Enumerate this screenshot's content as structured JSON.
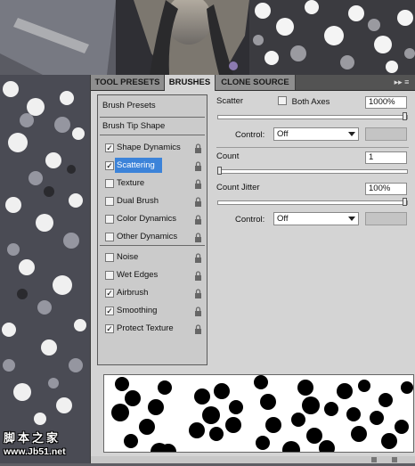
{
  "tabs": [
    {
      "label": "TOOL PRESETS",
      "active": false
    },
    {
      "label": "BRUSHES",
      "active": true
    },
    {
      "label": "CLONE SOURCE",
      "active": false
    }
  ],
  "menu_icon": "panel-menu-icon",
  "left_panel": {
    "brush_presets": "Brush Presets",
    "brush_tip_shape": "Brush Tip Shape",
    "options": [
      {
        "label": "Shape Dynamics",
        "checked": true,
        "selected": false
      },
      {
        "label": "Scattering",
        "checked": true,
        "selected": true
      },
      {
        "label": "Texture",
        "checked": false,
        "selected": false
      },
      {
        "label": "Dual Brush",
        "checked": false,
        "selected": false
      },
      {
        "label": "Color Dynamics",
        "checked": false,
        "selected": false
      },
      {
        "label": "Other Dynamics",
        "checked": false,
        "selected": false
      },
      {
        "label": "Noise",
        "checked": false,
        "selected": false
      },
      {
        "label": "Wet Edges",
        "checked": false,
        "selected": false
      },
      {
        "label": "Airbrush",
        "checked": true,
        "selected": false
      },
      {
        "label": "Smoothing",
        "checked": true,
        "selected": false
      },
      {
        "label": "Protect Texture",
        "checked": true,
        "selected": false
      }
    ]
  },
  "scatter": {
    "label": "Scatter",
    "both_axes_label": "Both Axes",
    "both_axes_checked": false,
    "value": "1000%",
    "slider_fraction": 1.0,
    "control_label": "Control:",
    "control_value": "Off"
  },
  "count": {
    "label": "Count",
    "value": "1",
    "slider_fraction": 0.0
  },
  "count_jitter": {
    "label": "Count Jitter",
    "value": "100%",
    "slider_fraction": 1.0,
    "control_label": "Control:",
    "control_value": "Off"
  },
  "watermark": {
    "line1": "脚本之家",
    "line2": "www.Jb51.net"
  },
  "colors": {
    "accent": "#3c83d9",
    "panel_bg": "#d4d4d4",
    "tab_bar": "#535353"
  }
}
